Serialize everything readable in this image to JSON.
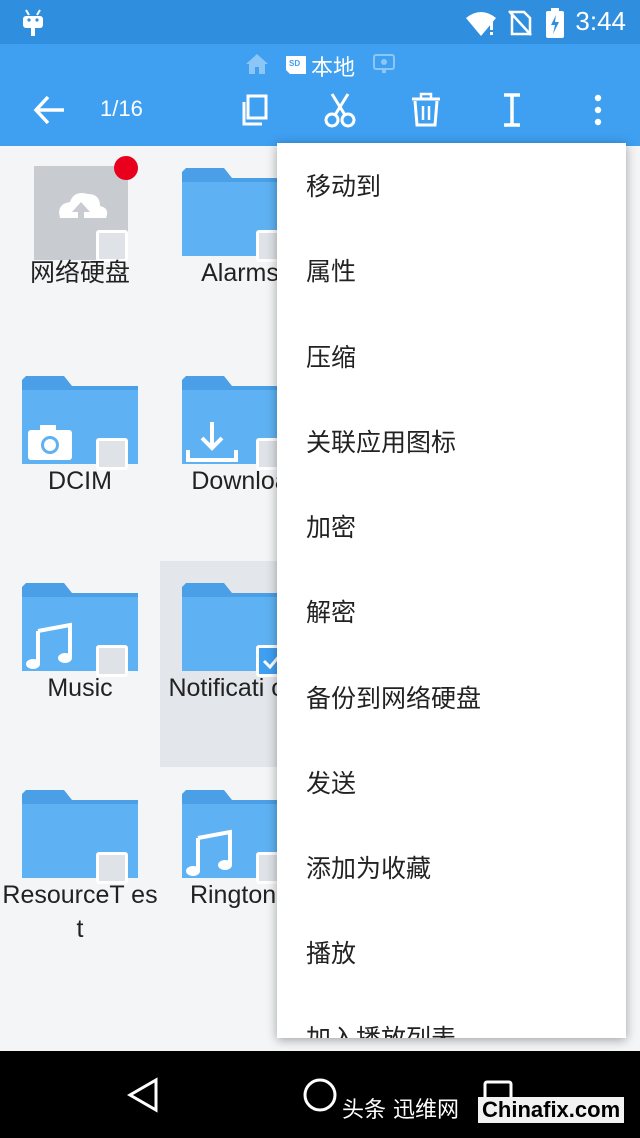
{
  "status_bar": {
    "time": "3:44",
    "icons": [
      "android-icon",
      "wifi-icon",
      "no-sim-icon",
      "battery-icon"
    ]
  },
  "breadcrumb": {
    "path_label": "本地",
    "icons": [
      "home-icon",
      "sd-card-icon",
      "network-icon"
    ]
  },
  "toolbar": {
    "selection_count": "1/16",
    "actions": [
      "back-arrow-icon",
      "copy-icon",
      "cut-icon",
      "delete-icon",
      "rename-icon",
      "more-vert-icon"
    ]
  },
  "grid": {
    "items": [
      {
        "label": "网络硬盘",
        "icon": "cloud-upload-icon",
        "checked": false,
        "badge": true
      },
      {
        "label": "Alarms",
        "icon": "folder-icon",
        "checked": false
      },
      {
        "label": "DCIM",
        "icon": "camera-icon",
        "checked": false
      },
      {
        "label": "Downloa",
        "icon": "download-icon",
        "checked": false
      },
      {
        "label": "Music",
        "icon": "music-note-icon",
        "checked": false
      },
      {
        "label": "Notificati ons",
        "icon": "folder-icon",
        "checked": true
      },
      {
        "label": "ResourceT est",
        "icon": "folder-icon",
        "checked": false
      },
      {
        "label": "Ringtone",
        "icon": "music-note-icon",
        "checked": false
      }
    ]
  },
  "menu": {
    "items": [
      "移动到",
      "属性",
      "压缩",
      "关联应用图标",
      "加密",
      "解密",
      "备份到网络硬盘",
      "发送",
      "添加为收藏",
      "播放",
      "加入播放列表"
    ]
  },
  "nav_bar": {
    "icons": [
      "nav-back-icon",
      "nav-home-icon",
      "nav-recents-icon"
    ]
  },
  "watermark": {
    "text1": "头条 迅维网",
    "text2": "Chinafix.com"
  },
  "colors": {
    "appbar": "#3f9ff0",
    "statusbar": "#2f8fde",
    "folder": "#5eb2f3",
    "folder_dark": "#4a9fe6",
    "badge": "#e8001c"
  }
}
